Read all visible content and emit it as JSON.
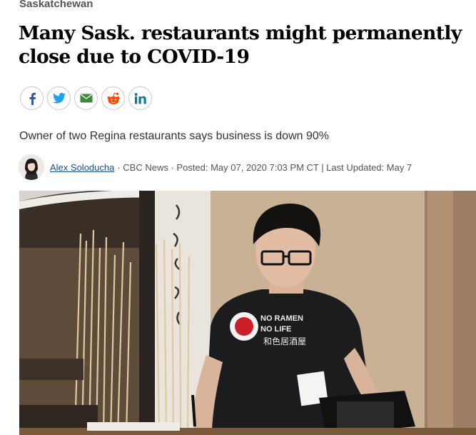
{
  "section": {
    "label": "Saskatchewan"
  },
  "article": {
    "headline": "Many Sask. restaurants might permanently close due to COVID-19",
    "deck": "Owner of two Regina restaurants says business is down 90%"
  },
  "share": {
    "buttons": [
      {
        "icon": "facebook-icon",
        "color": "#3b5998"
      },
      {
        "icon": "twitter-icon",
        "color": "#1da1f2"
      },
      {
        "icon": "email-icon",
        "color": "#3a8a3a"
      },
      {
        "icon": "reddit-icon",
        "color": "#ff4500"
      },
      {
        "icon": "linkedin-icon",
        "color": "#0e76a8"
      }
    ]
  },
  "byline": {
    "author": "Alex Soloducha",
    "meta": "· CBC News · Posted: May 07, 2020 7:03 PM CT | Last Updated: May 7"
  },
  "photo": {
    "shirt_line1": "NO RAMEN",
    "shirt_line2": "NO LIFE",
    "shirt_cjk": "和色居酒屋"
  }
}
